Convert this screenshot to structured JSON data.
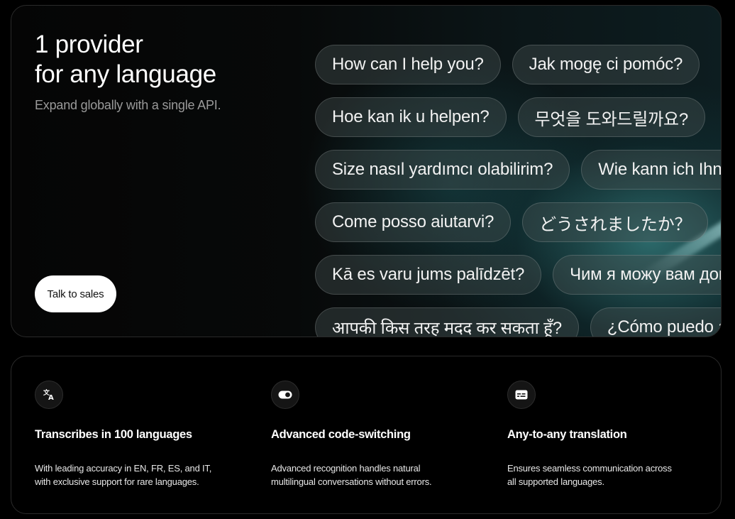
{
  "hero": {
    "title_line1": "1 provider",
    "title_line2": "for any language",
    "subtitle": "Expand globally with a single API.",
    "cta_label": "Talk to sales",
    "phrases": [
      [
        "How can I help you?",
        "Jak mogę ci pomóc?"
      ],
      [
        "Hoe kan ik u helpen?",
        "무엇을 도와드릴까요?"
      ],
      [
        "Size nasıl yardımcı olabilirim?",
        "Wie kann ich Ihnen helfen?"
      ],
      [
        "Come posso aiutarvi?",
        "どうされましたか？"
      ],
      [
        "Kā es varu jums palīdzēt?",
        "Чим я можу вам допомогти?"
      ],
      [
        "आपकी किस तरह मदद कर सकता हूँ?",
        "¿Cómo puedo ayudarle?"
      ]
    ]
  },
  "features": [
    {
      "icon": "translate-icon",
      "title": "Transcribes in 100 languages",
      "desc_line1": "With leading accuracy in EN, FR, ES, and IT,",
      "desc_line2": "with exclusive support for rare languages."
    },
    {
      "icon": "toggle-icon",
      "title": "Advanced code-switching",
      "desc_line1": "Advanced recognition handles natural",
      "desc_line2": "multilingual conversations without errors."
    },
    {
      "icon": "subtitles-icon",
      "title": "Any-to-any translation",
      "desc_line1": "Ensures seamless communication across",
      "desc_line2": "all supported languages."
    }
  ]
}
